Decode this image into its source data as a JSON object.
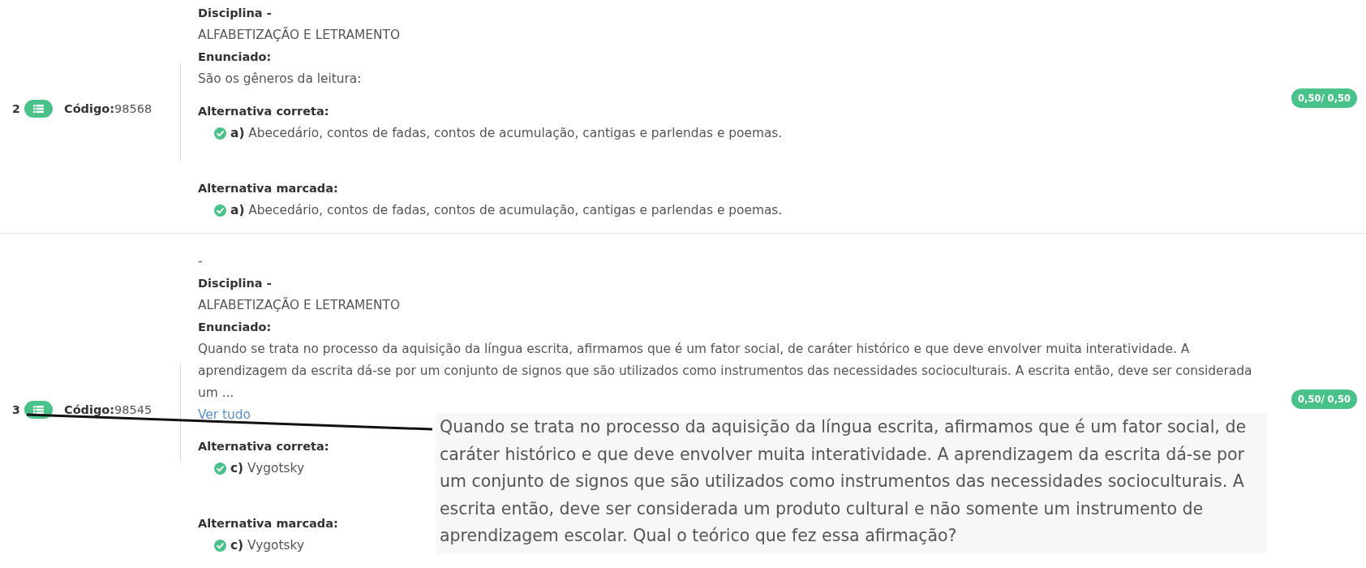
{
  "questions": [
    {
      "number": "2",
      "code": "**Código:**98568",
      "discipline_label": "Disciplina -",
      "discipline": "ALFABETIZAÇÃO E LETRAMENTO",
      "statement_label": "Enunciado:",
      "statement": "São os gêneros da leitura:",
      "answers": [
        {
          "label": "Alternativa correta:",
          "text": "**a)** Abecedário, contos de fadas, contos de acumulação, cantigas e parlendas e poemas.",
          "correct": true
        },
        {
          "label": "Alternativa marcada:",
          "text": "**a)** Abecedário, contos de fadas, contos de acumulação, cantigas e parlendas e poemas.",
          "correct": true
        }
      ],
      "score": "0,50/ 0,50"
    },
    {
      "number": "3",
      "code": "**Código:**98545",
      "preface": "-",
      "discipline_label": "Disciplina -",
      "discipline": "ALFABETIZAÇÃO E LETRAMENTO",
      "statement_label": "Enunciado:",
      "statement": "Quando se trata no processo da aquisição da língua escrita, afirmamos que é um fator social, de caráter histórico e que deve envolver muita interatividade. A aprendizagem da escrita dá-se por um conjunto de signos que são utilizados como instrumentos das necessidades socioculturais. A escrita então, deve ser considerada um ...",
      "more_link": "Ver tudo",
      "answers": [
        {
          "label": "Alternativa correta:",
          "text": "**c)** Vygotsky",
          "correct": true
        },
        {
          "label": "Alternativa marcada:",
          "text": "**c)** Vygotsky",
          "correct": true
        }
      ],
      "score": "0,50/ 0,50"
    }
  ],
  "tooltip": {
    "text": "Quando se trata no processo da aquisição da língua escrita, afirmamos que é um fator social, de caráter histórico e que deve envolver muita interatividade. A aprendizagem da escrita dá-se por um conjunto de signos que são utilizados como instrumentos das necessidades socioculturais. A escrita então, deve ser considerada um produto cultural e não somente um instrumento de aprendizagem escolar. Qual o teórico que fez essa afirmação?"
  }
}
